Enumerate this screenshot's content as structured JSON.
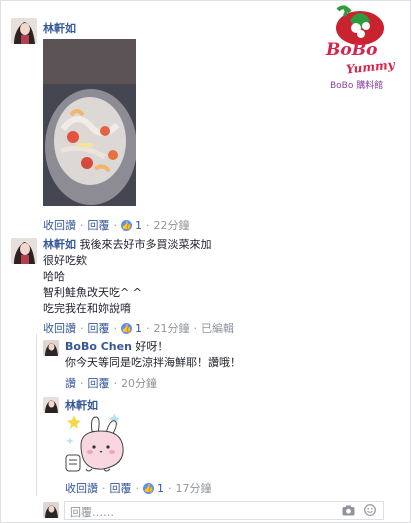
{
  "brand": {
    "logo_line1": "BoBo",
    "logo_line2": "Yummy",
    "logo_caption": "BoBo 購料館",
    "accent": "#d9234b"
  },
  "comments": [
    {
      "author": "林軒如",
      "text_lines": [],
      "has_photo": true,
      "actions": {
        "like": "收回讚",
        "reply": "回覆",
        "like_count": "1",
        "time": "22分鐘",
        "edited": ""
      }
    },
    {
      "author": "林軒如",
      "text_lines": [
        "我後來去好市多買淡菜來加",
        "很好吃欸",
        "哈哈",
        "智利鮭魚改天吃^ ^",
        "吃完我在和妳說唷"
      ],
      "actions": {
        "like": "收回讚",
        "reply": "回覆",
        "like_count": "1",
        "time": "21分鐘",
        "edited": "已編輯"
      }
    }
  ],
  "replies": [
    {
      "author": "BoBo Chen",
      "text_lines": [
        "好呀！",
        "你今天等同是吃涼拌海鮮耶！讚哦！"
      ],
      "actions": {
        "like": "讚",
        "reply": "回覆",
        "time": "20分鐘"
      }
    },
    {
      "author": "林軒如",
      "has_sticker": true,
      "actions": {
        "like": "收回讚",
        "reply": "回覆",
        "like_count": "1",
        "time": "17分鐘"
      }
    }
  ],
  "reply_input": {
    "placeholder": "回覆……"
  },
  "icons": {
    "like": "thumbs-up-icon",
    "camera": "camera-icon",
    "emoji": "emoji-icon"
  }
}
